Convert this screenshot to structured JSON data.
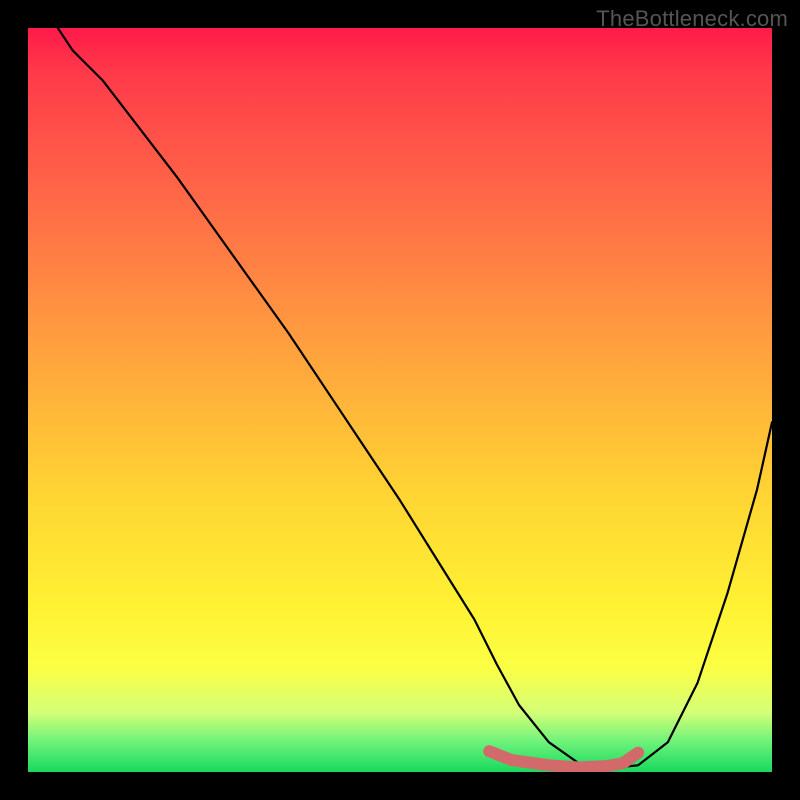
{
  "watermark": "TheBottleneck.com",
  "chart_data": {
    "type": "line",
    "title": "",
    "xlabel": "",
    "ylabel": "",
    "xlim": [
      0,
      100
    ],
    "ylim": [
      0,
      100
    ],
    "series": [
      {
        "name": "bottleneck-curve",
        "x": [
          4,
          6,
          10,
          15,
          20,
          25,
          30,
          35,
          40,
          45,
          50,
          55,
          60,
          63,
          66,
          70,
          74,
          78,
          82,
          86,
          90,
          94,
          98,
          100
        ],
        "y": [
          100,
          97,
          93,
          86.5,
          80,
          73,
          66,
          59,
          51.5,
          44,
          36.5,
          28.5,
          20.5,
          14.5,
          9,
          4,
          1.2,
          0.5,
          0.9,
          4,
          12,
          24,
          38,
          47
        ]
      }
    ],
    "highlight_band": {
      "name": "optimal-range",
      "x": [
        62,
        65,
        70,
        74,
        78,
        80,
        82
      ],
      "y": [
        2.8,
        1.6,
        0.9,
        0.6,
        0.8,
        1.2,
        2.6
      ],
      "color": "#d2696b"
    }
  }
}
